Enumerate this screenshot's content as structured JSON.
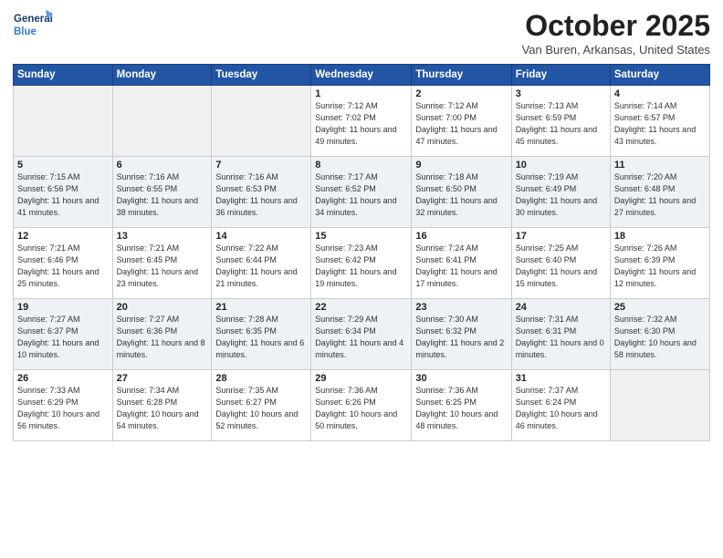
{
  "logo": {
    "line1": "General",
    "line2": "Blue"
  },
  "header": {
    "month": "October 2025",
    "location": "Van Buren, Arkansas, United States"
  },
  "days_of_week": [
    "Sunday",
    "Monday",
    "Tuesday",
    "Wednesday",
    "Thursday",
    "Friday",
    "Saturday"
  ],
  "weeks": [
    [
      {
        "num": "",
        "empty": true
      },
      {
        "num": "",
        "empty": true
      },
      {
        "num": "",
        "empty": true
      },
      {
        "num": "1",
        "sunrise": "7:12 AM",
        "sunset": "7:02 PM",
        "daylight": "11 hours and 49 minutes."
      },
      {
        "num": "2",
        "sunrise": "7:12 AM",
        "sunset": "7:00 PM",
        "daylight": "11 hours and 47 minutes."
      },
      {
        "num": "3",
        "sunrise": "7:13 AM",
        "sunset": "6:59 PM",
        "daylight": "11 hours and 45 minutes."
      },
      {
        "num": "4",
        "sunrise": "7:14 AM",
        "sunset": "6:57 PM",
        "daylight": "11 hours and 43 minutes."
      }
    ],
    [
      {
        "num": "5",
        "sunrise": "7:15 AM",
        "sunset": "6:56 PM",
        "daylight": "11 hours and 41 minutes."
      },
      {
        "num": "6",
        "sunrise": "7:16 AM",
        "sunset": "6:55 PM",
        "daylight": "11 hours and 38 minutes."
      },
      {
        "num": "7",
        "sunrise": "7:16 AM",
        "sunset": "6:53 PM",
        "daylight": "11 hours and 36 minutes."
      },
      {
        "num": "8",
        "sunrise": "7:17 AM",
        "sunset": "6:52 PM",
        "daylight": "11 hours and 34 minutes."
      },
      {
        "num": "9",
        "sunrise": "7:18 AM",
        "sunset": "6:50 PM",
        "daylight": "11 hours and 32 minutes."
      },
      {
        "num": "10",
        "sunrise": "7:19 AM",
        "sunset": "6:49 PM",
        "daylight": "11 hours and 30 minutes."
      },
      {
        "num": "11",
        "sunrise": "7:20 AM",
        "sunset": "6:48 PM",
        "daylight": "11 hours and 27 minutes."
      }
    ],
    [
      {
        "num": "12",
        "sunrise": "7:21 AM",
        "sunset": "6:46 PM",
        "daylight": "11 hours and 25 minutes."
      },
      {
        "num": "13",
        "sunrise": "7:21 AM",
        "sunset": "6:45 PM",
        "daylight": "11 hours and 23 minutes."
      },
      {
        "num": "14",
        "sunrise": "7:22 AM",
        "sunset": "6:44 PM",
        "daylight": "11 hours and 21 minutes."
      },
      {
        "num": "15",
        "sunrise": "7:23 AM",
        "sunset": "6:42 PM",
        "daylight": "11 hours and 19 minutes."
      },
      {
        "num": "16",
        "sunrise": "7:24 AM",
        "sunset": "6:41 PM",
        "daylight": "11 hours and 17 minutes."
      },
      {
        "num": "17",
        "sunrise": "7:25 AM",
        "sunset": "6:40 PM",
        "daylight": "11 hours and 15 minutes."
      },
      {
        "num": "18",
        "sunrise": "7:26 AM",
        "sunset": "6:39 PM",
        "daylight": "11 hours and 12 minutes."
      }
    ],
    [
      {
        "num": "19",
        "sunrise": "7:27 AM",
        "sunset": "6:37 PM",
        "daylight": "11 hours and 10 minutes."
      },
      {
        "num": "20",
        "sunrise": "7:27 AM",
        "sunset": "6:36 PM",
        "daylight": "11 hours and 8 minutes."
      },
      {
        "num": "21",
        "sunrise": "7:28 AM",
        "sunset": "6:35 PM",
        "daylight": "11 hours and 6 minutes."
      },
      {
        "num": "22",
        "sunrise": "7:29 AM",
        "sunset": "6:34 PM",
        "daylight": "11 hours and 4 minutes."
      },
      {
        "num": "23",
        "sunrise": "7:30 AM",
        "sunset": "6:32 PM",
        "daylight": "11 hours and 2 minutes."
      },
      {
        "num": "24",
        "sunrise": "7:31 AM",
        "sunset": "6:31 PM",
        "daylight": "11 hours and 0 minutes."
      },
      {
        "num": "25",
        "sunrise": "7:32 AM",
        "sunset": "6:30 PM",
        "daylight": "10 hours and 58 minutes."
      }
    ],
    [
      {
        "num": "26",
        "sunrise": "7:33 AM",
        "sunset": "6:29 PM",
        "daylight": "10 hours and 56 minutes."
      },
      {
        "num": "27",
        "sunrise": "7:34 AM",
        "sunset": "6:28 PM",
        "daylight": "10 hours and 54 minutes."
      },
      {
        "num": "28",
        "sunrise": "7:35 AM",
        "sunset": "6:27 PM",
        "daylight": "10 hours and 52 minutes."
      },
      {
        "num": "29",
        "sunrise": "7:36 AM",
        "sunset": "6:26 PM",
        "daylight": "10 hours and 50 minutes."
      },
      {
        "num": "30",
        "sunrise": "7:36 AM",
        "sunset": "6:25 PM",
        "daylight": "10 hours and 48 minutes."
      },
      {
        "num": "31",
        "sunrise": "7:37 AM",
        "sunset": "6:24 PM",
        "daylight": "10 hours and 46 minutes."
      },
      {
        "num": "",
        "empty": true
      }
    ]
  ],
  "row_styles": [
    "row-white",
    "row-gray",
    "row-white",
    "row-gray",
    "row-white"
  ]
}
